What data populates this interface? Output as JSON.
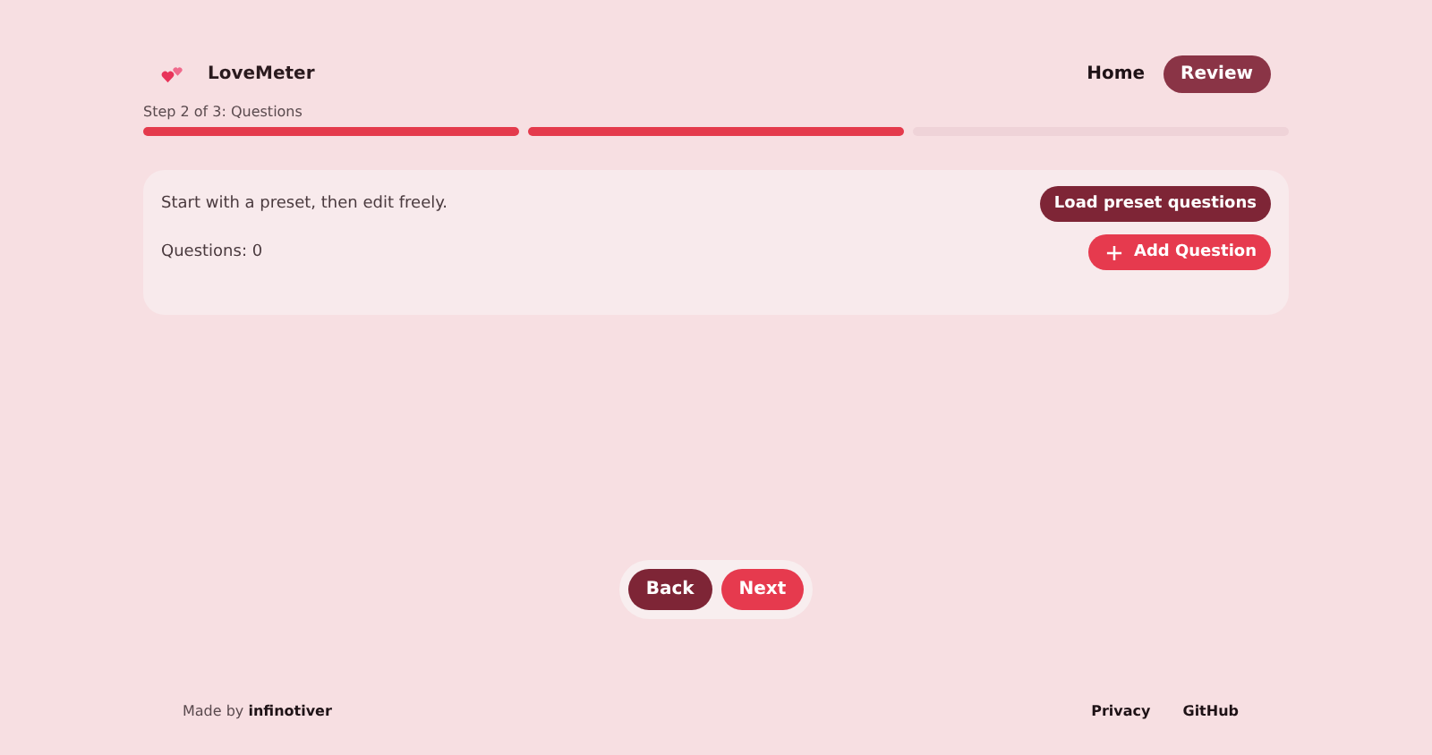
{
  "header": {
    "brand": "LoveMeter",
    "nav": [
      {
        "label": "Home",
        "selected": false
      },
      {
        "label": "Review",
        "selected": true
      }
    ]
  },
  "progress": {
    "label": "Step 2 of 3: Questions",
    "segments": [
      {
        "done": true
      },
      {
        "done": true
      },
      {
        "done": false
      }
    ]
  },
  "card": {
    "hint": "Start with a preset, then edit freely.",
    "preset_button": "Load preset questions",
    "count": "Questions: 0",
    "add_button": "Add Question"
  },
  "wizard_buttons": [
    {
      "label": "Back",
      "kind": "back"
    },
    {
      "label": "Next",
      "kind": "next"
    }
  ],
  "footer": {
    "credit": "Made by **infinotiver**",
    "links": [
      "Privacy",
      "GitHub"
    ]
  }
}
